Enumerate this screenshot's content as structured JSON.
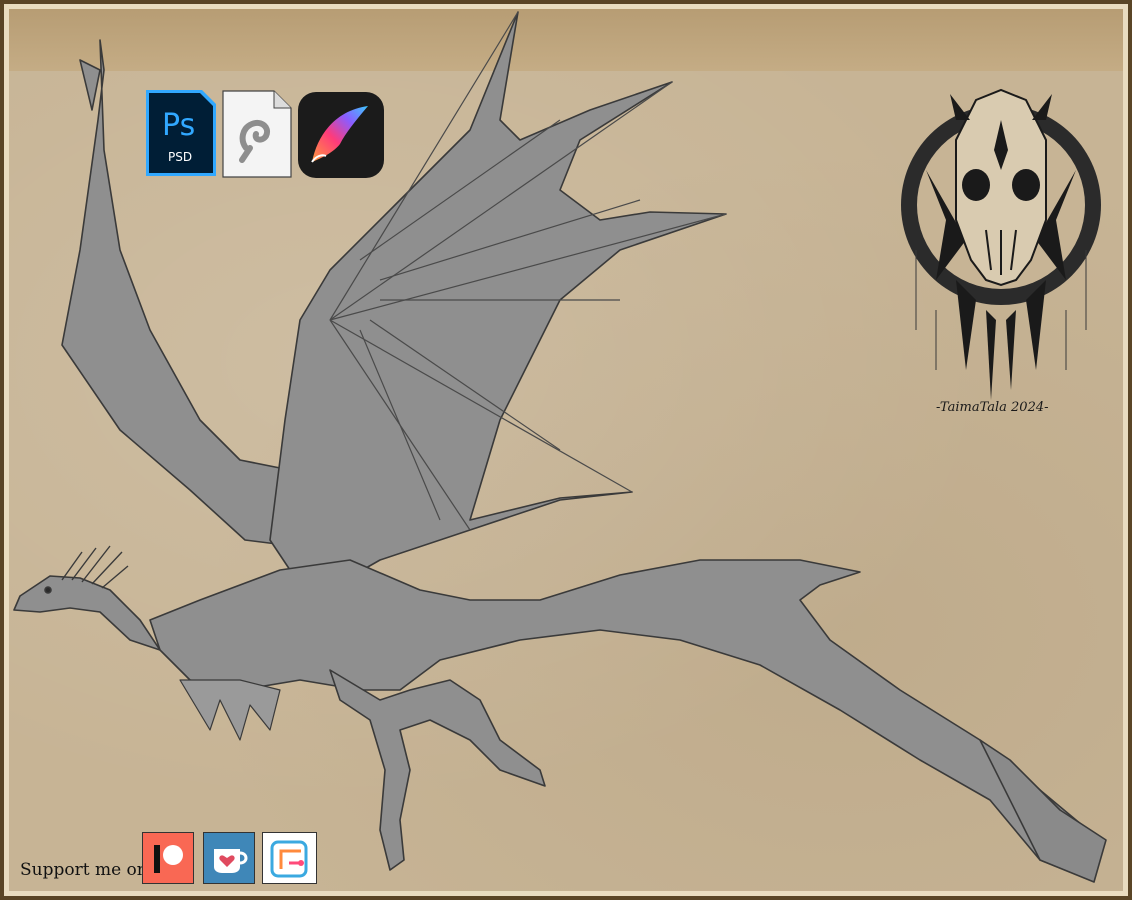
{
  "support": {
    "label": "Support me on:"
  },
  "software_icons": [
    {
      "name": "photoshop",
      "ps_text": "Ps",
      "psd_text": "PSD"
    },
    {
      "name": "clip-studio"
    },
    {
      "name": "procreate"
    }
  ],
  "social_icons": [
    {
      "name": "patreon"
    },
    {
      "name": "ko-fi"
    },
    {
      "name": "gumroad"
    }
  ],
  "emblem": {
    "signature": "-TaimaTala 2024-"
  },
  "colors": {
    "frame": "#5a4526",
    "paper": "#c7b495",
    "creature": "#8f8f8f",
    "linework": "#3a3a3a",
    "photoshop": "#31a8ff",
    "patreon": "#f96854",
    "kofi": "#3f87b8"
  }
}
